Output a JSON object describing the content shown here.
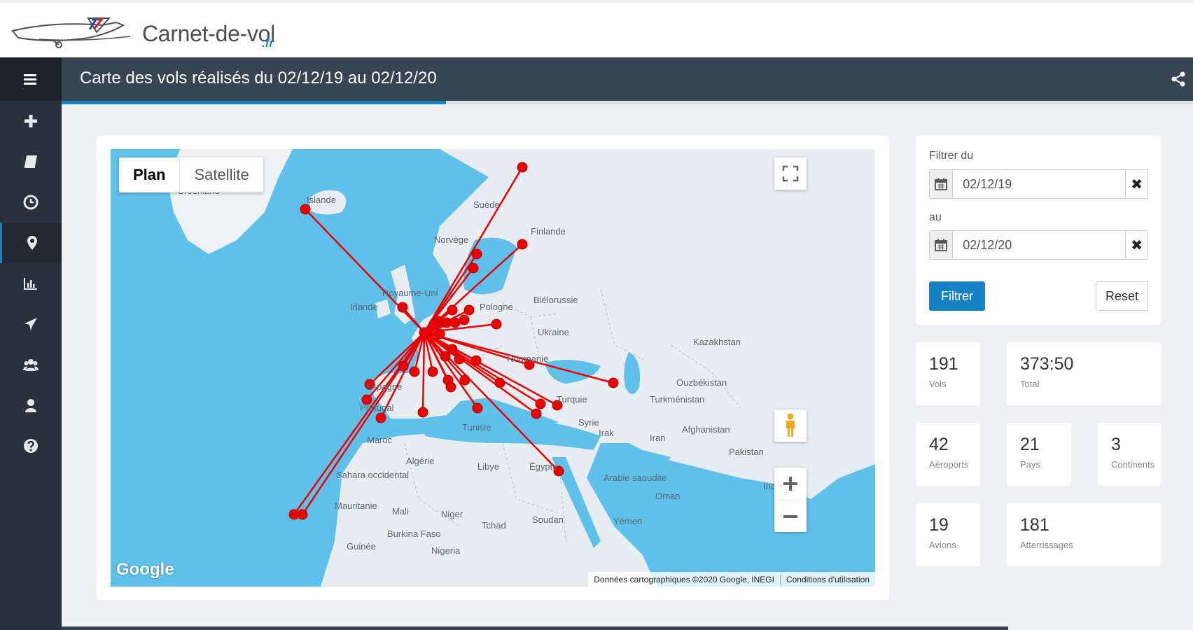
{
  "header": {
    "logo_text": "Carnet-de-vol",
    "logo_tld": ".fr",
    "page_title": "Carte des vols réalisés du 02/12/19 au 02/12/20",
    "progress_fraction": 0.34
  },
  "sidebar": {
    "items": [
      {
        "icon": "menu-icon"
      },
      {
        "icon": "plus-icon"
      },
      {
        "icon": "book-icon"
      },
      {
        "icon": "clock-icon"
      },
      {
        "icon": "map-marker-icon",
        "active": true
      },
      {
        "icon": "bar-chart-icon"
      },
      {
        "icon": "plane-icon"
      },
      {
        "icon": "users-icon"
      },
      {
        "icon": "user-icon"
      },
      {
        "icon": "question-icon"
      }
    ]
  },
  "map": {
    "type_plan": "Plan",
    "type_satellite": "Satellite",
    "google_logo": "Google",
    "attribution": "Données cartographiques ©2020 Google, INEGI",
    "terms": "Conditions d'utilisation",
    "labels": [
      "Groenland",
      "Islande",
      "Suède",
      "Finlande",
      "Norvège",
      "Royaume-Uni",
      "Irlande",
      "Biélorussie",
      "Pologne",
      "Ukraine",
      "Kazakhstan",
      "Roumanie",
      "Espagne",
      "Portugal",
      "Ouzbékistan",
      "Turkménistan",
      "Turquie",
      "Syrie",
      "Irak",
      "Iran",
      "Afghanistan",
      "Pakistan",
      "Maroc",
      "Algérie",
      "Tunisie",
      "Libye",
      "Égypte",
      "Arabie saoudite",
      "Oman",
      "Sahara occidental",
      "Mauritanie",
      "Mali",
      "Niger",
      "Tchad",
      "Soudan",
      "Yémen",
      "Burkina Faso",
      "Guinée",
      "Nigeria",
      "Inde"
    ],
    "colors": {
      "sea": "#5fc0ea",
      "land": "#e8edf1",
      "route": "#ee0000"
    }
  },
  "filter": {
    "from_label": "Filtrer du",
    "from_value": "02/12/19",
    "to_label": "au",
    "to_value": "02/12/20",
    "filter_button": "Filtrer",
    "reset_button": "Reset",
    "clear_symbol": "✖"
  },
  "stats": [
    {
      "value": "191",
      "label": "Vols"
    },
    {
      "value": "373:50",
      "label": "Total"
    },
    {
      "value": "42",
      "label": "Aéroports"
    },
    {
      "value": "21",
      "label": "Pays"
    },
    {
      "value": "3",
      "label": "Continents"
    },
    {
      "value": "19",
      "label": "Avions"
    },
    {
      "value": "181",
      "label": "Atterrissages"
    }
  ]
}
